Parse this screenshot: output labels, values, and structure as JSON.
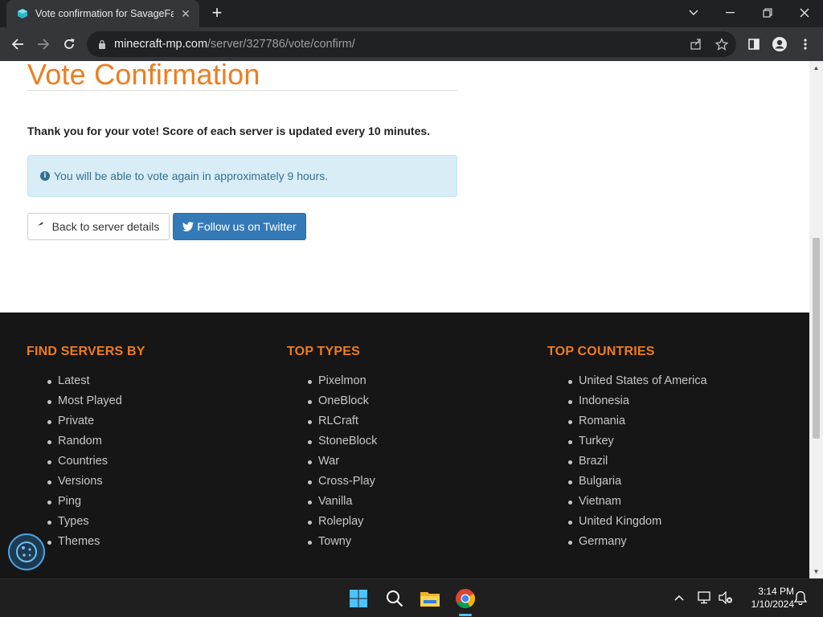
{
  "browser": {
    "tab_title": "Vote confirmation for SavageFact",
    "new_tab_label": "+",
    "url_host": "minecraft-mp.com",
    "url_path": "/server/327786/vote/confirm/"
  },
  "page": {
    "title": "Vote Confirmation",
    "thanks": "Thank you for your vote! Score of each server is updated every 10 minutes.",
    "alert": "You will be able to vote again in approximately 9 hours.",
    "back_button": "Back to server details",
    "twitter_button": "Follow us on Twitter"
  },
  "footer": {
    "columns": [
      {
        "heading": "FIND SERVERS BY",
        "items": [
          "Latest",
          "Most Played",
          "Private",
          "Random",
          "Countries",
          "Versions",
          "Ping",
          "Types",
          "Themes"
        ]
      },
      {
        "heading": "TOP TYPES",
        "items": [
          "Pixelmon",
          "OneBlock",
          "RLCraft",
          "StoneBlock",
          "War",
          "Cross-Play",
          "Vanilla",
          "Roleplay",
          "Towny"
        ]
      },
      {
        "heading": "TOP COUNTRIES",
        "items": [
          "United States of America",
          "Indonesia",
          "Romania",
          "Turkey",
          "Brazil",
          "Bulgaria",
          "Vietnam",
          "United Kingdom",
          "Germany"
        ]
      }
    ]
  },
  "taskbar": {
    "time": "3:14 PM",
    "date": "1/10/2024"
  },
  "colors": {
    "accent_orange": "#ee7d20",
    "primary_blue": "#337ab7",
    "alert_bg": "#d9edf7",
    "footer_bg": "#161616"
  }
}
